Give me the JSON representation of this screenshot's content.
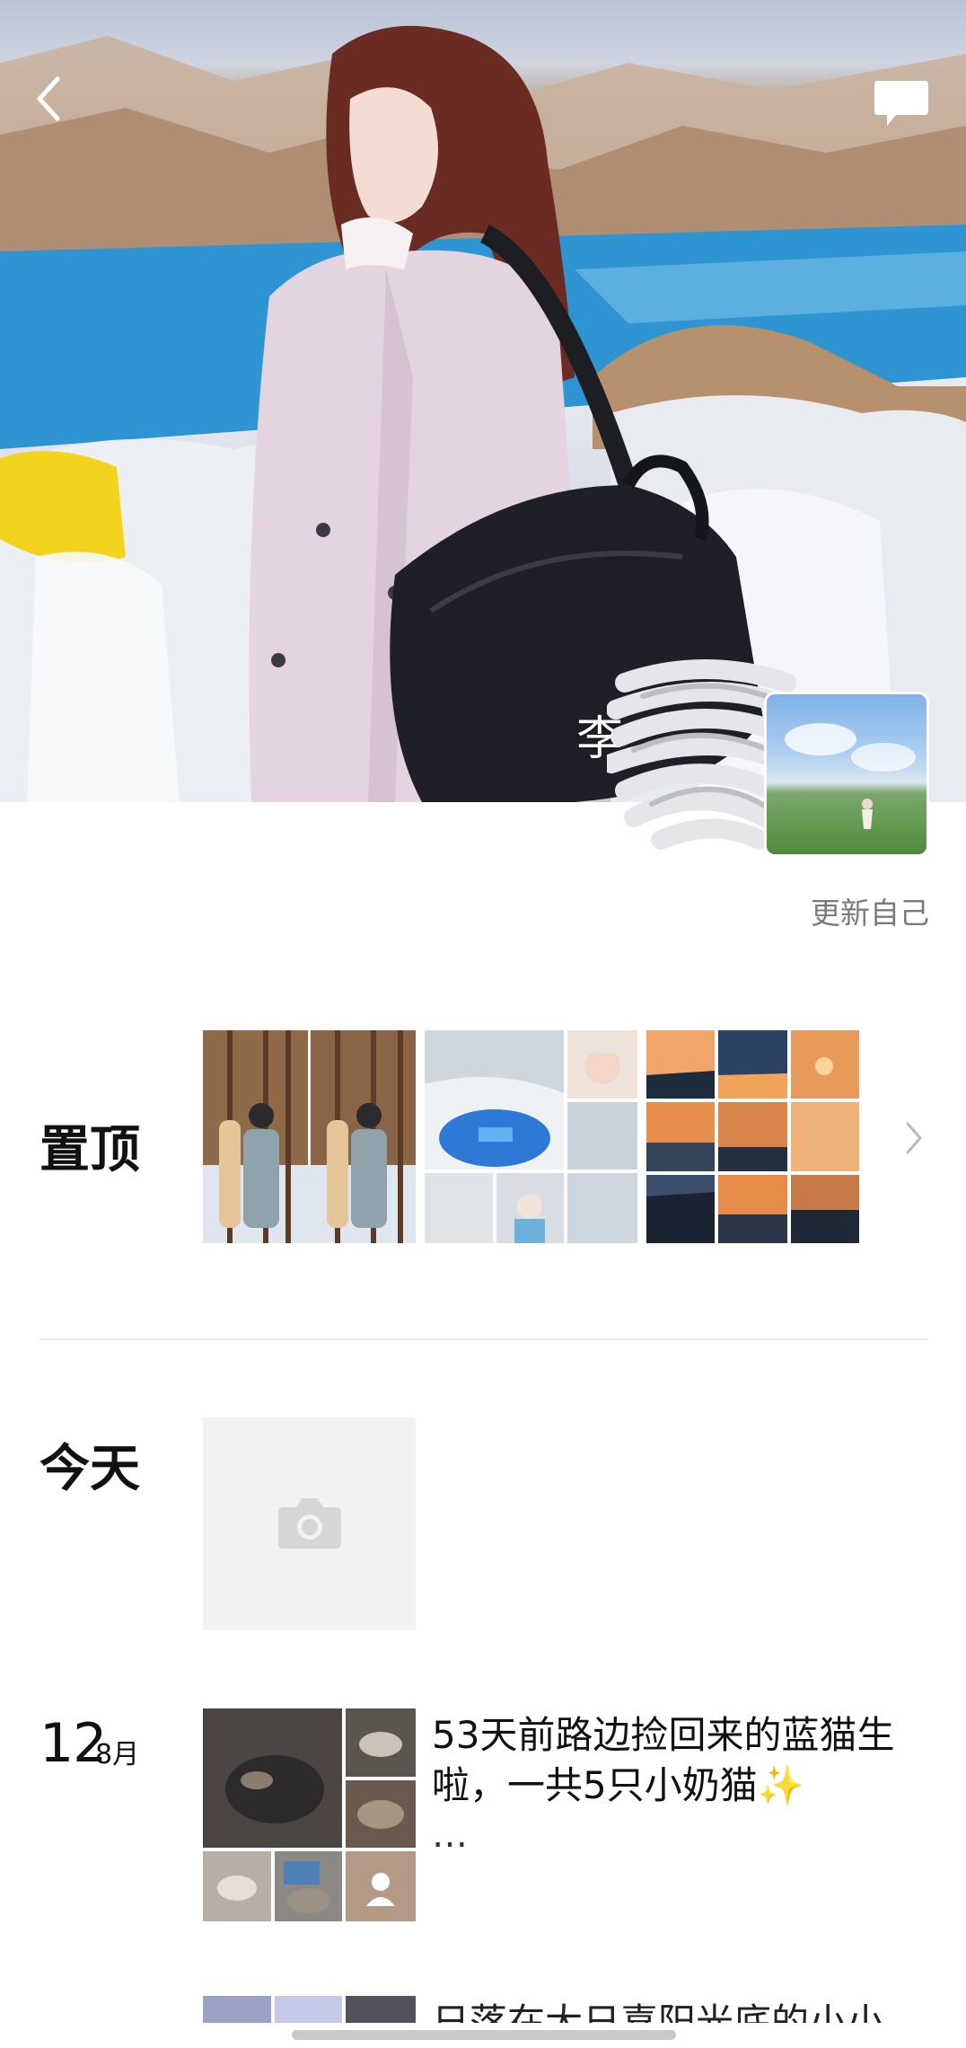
{
  "header": {
    "back_icon": "chevron-left-icon",
    "message_icon": "chat-bubble-icon"
  },
  "profile": {
    "username": "李",
    "update_self_label": "更新自己"
  },
  "sections": {
    "pinned_label": "置顶",
    "today_label": "今天",
    "today_placeholder_icon": "camera-icon",
    "post": {
      "day": "12",
      "month": "8月",
      "text": "53天前路边捡回来的蓝猫生啦，一共5只小奶猫✨",
      "ellipsis": "…"
    },
    "next_post_peek_text": "日落在大日喜阳光底的小小"
  },
  "colors": {
    "sky": "#5fa9d8",
    "lake": "#2f95d2",
    "divider": "#ececec",
    "secondary_text": "#7b7b7b"
  }
}
